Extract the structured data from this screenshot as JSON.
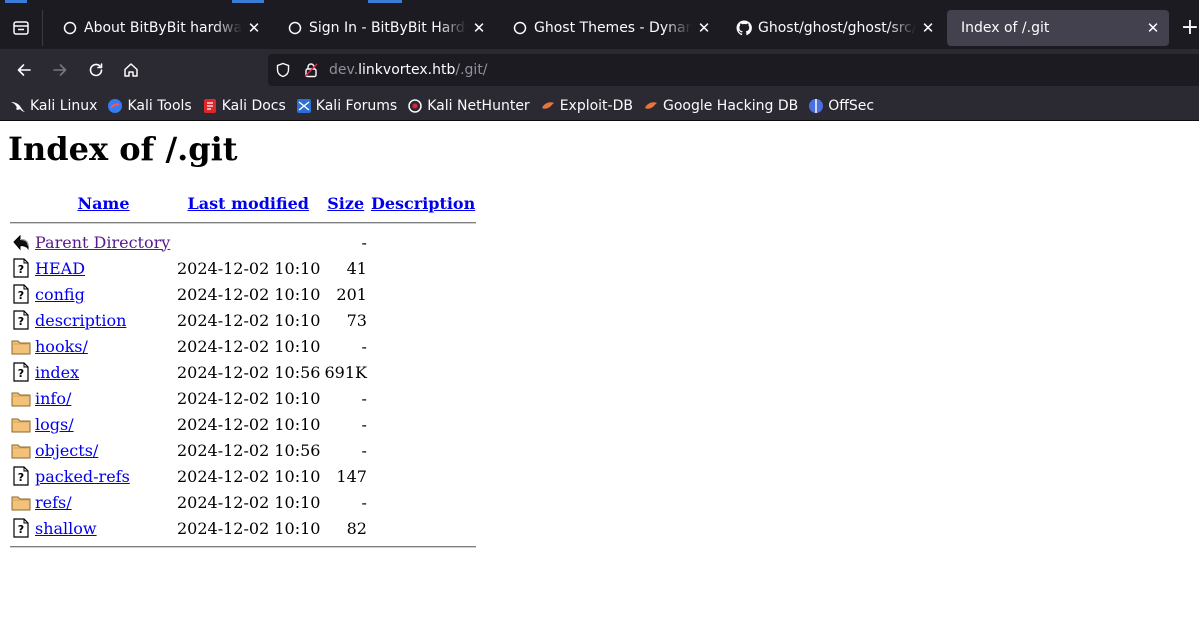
{
  "browser": {
    "tabs": [
      {
        "title": "About BitByBit hardware",
        "icon": "globe-icon",
        "active": false
      },
      {
        "title": "Sign In - BitByBit Hardware",
        "icon": "globe-icon",
        "active": false
      },
      {
        "title": "Ghost Themes - Dynamic",
        "icon": "globe-icon",
        "active": false
      },
      {
        "title": "Ghost/ghost/ghost/src/core",
        "icon": "github-icon",
        "active": false
      },
      {
        "title": "Index of /.git",
        "icon": "none",
        "active": true
      }
    ],
    "close_glyph": "✕",
    "new_tab_glyph": "+",
    "url": {
      "prefix": "dev.",
      "host": "linkvortex.htb",
      "path": "/.git/"
    },
    "bookmarks": [
      {
        "label": "Kali Linux",
        "icon": "kali-dragon-icon"
      },
      {
        "label": "Kali Tools",
        "icon": "kali-tools-icon"
      },
      {
        "label": "Kali Docs",
        "icon": "kali-docs-icon"
      },
      {
        "label": "Kali Forums",
        "icon": "kali-forums-icon"
      },
      {
        "label": "Kali NetHunter",
        "icon": "nethunter-icon"
      },
      {
        "label": "Exploit-DB",
        "icon": "exploit-db-icon"
      },
      {
        "label": "Google Hacking DB",
        "icon": "ghdb-icon"
      },
      {
        "label": "OffSec",
        "icon": "offsec-icon"
      }
    ],
    "accent_color": "#3a7bd5"
  },
  "page": {
    "heading": "Index of /.git",
    "columns": {
      "name": "Name",
      "modified": "Last modified",
      "size": "Size",
      "description": "Description"
    },
    "parent": {
      "label": "Parent Directory",
      "size": "-"
    },
    "entries": [
      {
        "name": "HEAD",
        "modified": "2024-12-02 10:10",
        "size": "41",
        "type": "file"
      },
      {
        "name": "config",
        "modified": "2024-12-02 10:10",
        "size": "201",
        "type": "file"
      },
      {
        "name": "description",
        "modified": "2024-12-02 10:10",
        "size": "73",
        "type": "file"
      },
      {
        "name": "hooks/",
        "modified": "2024-12-02 10:10",
        "size": "-",
        "type": "folder"
      },
      {
        "name": "index",
        "modified": "2024-12-02 10:56",
        "size": "691K",
        "type": "file"
      },
      {
        "name": "info/",
        "modified": "2024-12-02 10:10",
        "size": "-",
        "type": "folder"
      },
      {
        "name": "logs/",
        "modified": "2024-12-02 10:10",
        "size": "-",
        "type": "folder"
      },
      {
        "name": "objects/",
        "modified": "2024-12-02 10:56",
        "size": "-",
        "type": "folder"
      },
      {
        "name": "packed-refs",
        "modified": "2024-12-02 10:10",
        "size": "147",
        "type": "file"
      },
      {
        "name": "refs/",
        "modified": "2024-12-02 10:10",
        "size": "-",
        "type": "folder"
      },
      {
        "name": "shallow",
        "modified": "2024-12-02 10:10",
        "size": "82",
        "type": "file"
      }
    ],
    "link_color": "#0000ee",
    "visited_color": "#551a8b"
  }
}
